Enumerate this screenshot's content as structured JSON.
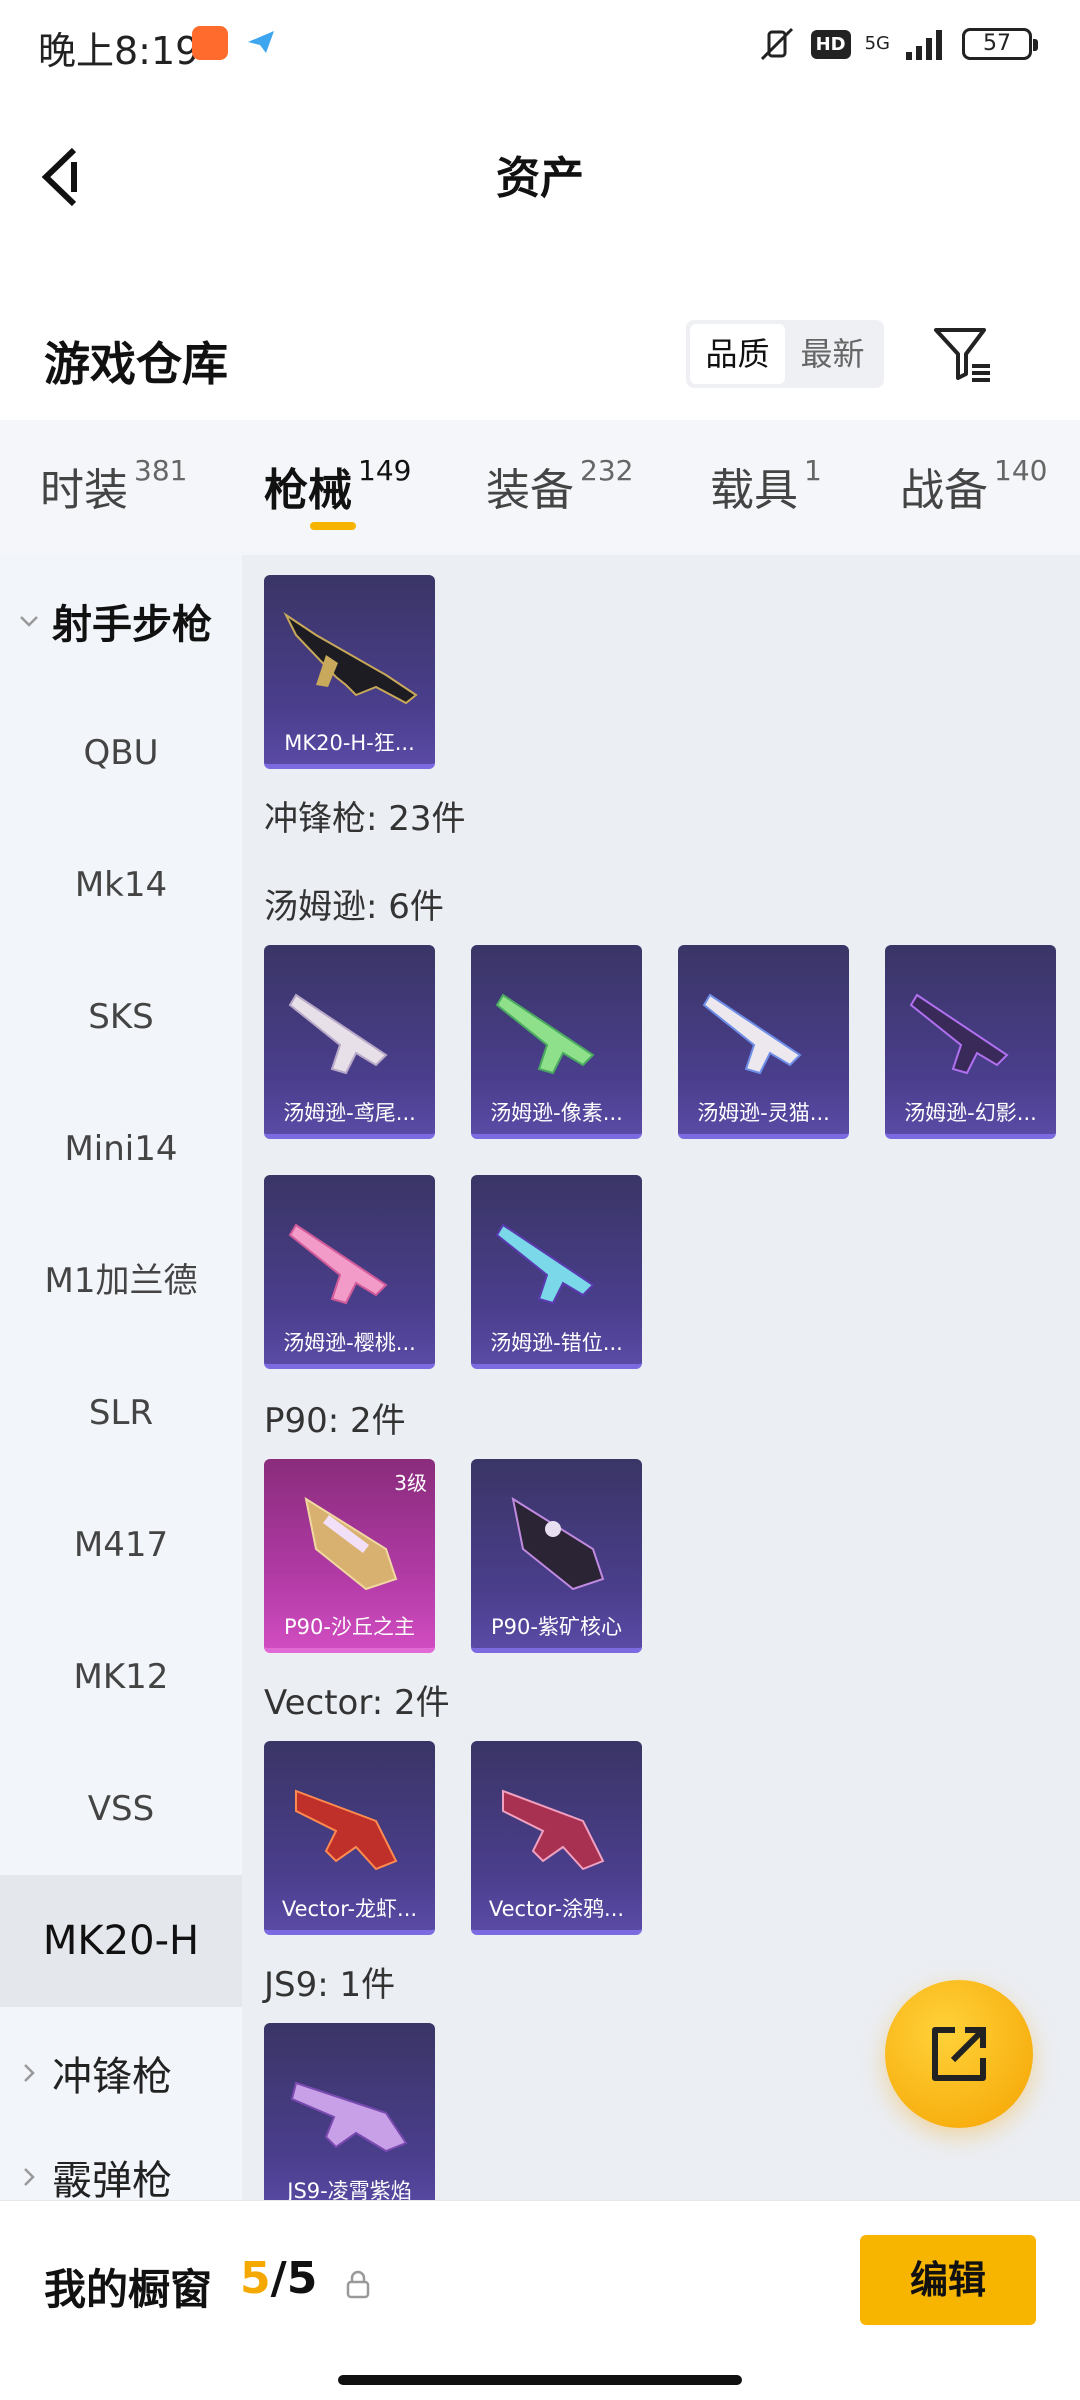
{
  "status_bar": {
    "time": "晚上8:19",
    "hd": "HD",
    "network": "5G",
    "battery": "57"
  },
  "header": {
    "title": "资产"
  },
  "section": {
    "title": "游戏仓库",
    "sort_options": [
      "品质",
      "最新"
    ],
    "sort_selected": "品质"
  },
  "category_tabs": [
    {
      "label": "时装",
      "count": "381"
    },
    {
      "label": "枪械",
      "count": "149"
    },
    {
      "label": "装备",
      "count": "232"
    },
    {
      "label": "载具",
      "count": "1"
    },
    {
      "label": "战备",
      "count": "140"
    }
  ],
  "sidebar": {
    "group_expanded": "射手步枪",
    "items": [
      "QBU",
      "Mk14",
      "SKS",
      "Mini14",
      "M1加兰德",
      "SLR",
      "M417",
      "MK12",
      "VSS",
      "MK20-H"
    ],
    "active_item": "MK20-H",
    "group_collapsed_1": "冲锋枪",
    "group_collapsed_2": "霰弹枪"
  },
  "main": {
    "top_card": "MK20-H-狂...",
    "group_smg": "冲锋枪: 23件",
    "group_thompson": "汤姆逊: 6件",
    "thompson_cards": [
      "汤姆逊-鸢尾...",
      "汤姆逊-像素...",
      "汤姆逊-灵猫...",
      "汤姆逊-幻影...",
      "汤姆逊-樱桃...",
      "汤姆逊-错位..."
    ],
    "group_p90": "P90: 2件",
    "p90_cards": [
      "P90-沙丘之主",
      "P90-紫矿核心"
    ],
    "p90_level": "3级",
    "group_vector": "Vector: 2件",
    "vector_cards": [
      "Vector-龙虾...",
      "Vector-涂鸦..."
    ],
    "group_js9": "JS9: 1件",
    "js9_cards": [
      "JS9-凌霄紫焰"
    ]
  },
  "bottom_bar": {
    "label": "我的橱窗",
    "current": "5",
    "separator": "/",
    "total": "5",
    "edit_label": "编辑"
  },
  "colors": {
    "accent": "#f7b500",
    "card_purple": "#4a3e8c",
    "card_gold": "#b03aa4"
  }
}
